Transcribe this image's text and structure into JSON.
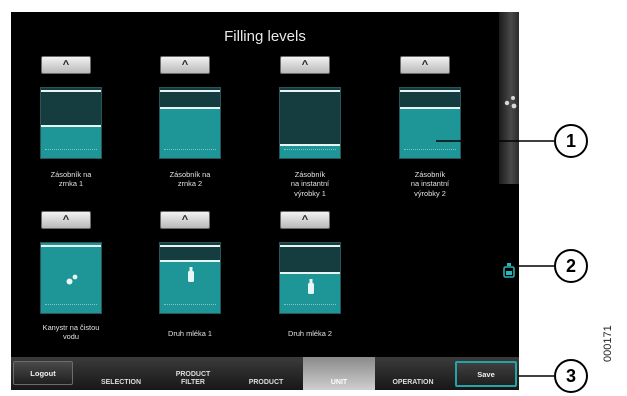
{
  "title": "Filling levels",
  "tiles": [
    {
      "label": [
        "Zásobník na",
        "zrnka 1"
      ],
      "level": 0.45,
      "icon": ""
    },
    {
      "label": [
        "Zásobník na",
        "zrnka 2"
      ],
      "level": 0.7,
      "icon": ""
    },
    {
      "label": [
        "Zásobník",
        "na instantní",
        "výrobky 1"
      ],
      "level": 0.18,
      "icon": ""
    },
    {
      "label": [
        "Zásobník",
        "na instantní",
        "výrobky 2"
      ],
      "level": 0.7,
      "icon": ""
    },
    {
      "label": [
        "Kanystr na čistou",
        "vodu"
      ],
      "level": 1.0,
      "icon": "water-drops-icon"
    },
    {
      "label": [
        "Druh mléka 1"
      ],
      "level": 0.72,
      "icon": "milk-bottle-icon"
    },
    {
      "label": [
        "Druh mléka 2"
      ],
      "level": 0.55,
      "icon": "milk-bottle-icon"
    }
  ],
  "arrow_label": "^",
  "bottom_bar": {
    "logout": "Logout",
    "tabs": [
      "SELECTION",
      "PRODUCT FILTER",
      "PRODUCT",
      "UNIT",
      "OPERATION"
    ],
    "active_tab": "UNIT",
    "save": "Save"
  },
  "callouts": [
    "1",
    "2",
    "3"
  ],
  "doc_code": "000171",
  "colors": {
    "accent": "#1e9697",
    "save_border": "#25a3a8",
    "background": "#000000"
  },
  "side_icons": [
    "water-drops-icon",
    "milk-container-icon"
  ]
}
